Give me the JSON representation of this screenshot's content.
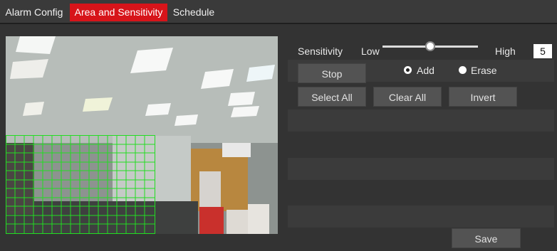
{
  "tabs": {
    "alarm_config": "Alarm Config",
    "area_sensitivity": "Area and Sensitivity",
    "schedule": "Schedule"
  },
  "sensitivity": {
    "label": "Sensitivity",
    "low": "Low",
    "high": "High",
    "value": "5",
    "level_fraction": 0.5
  },
  "controls": {
    "stop": "Stop",
    "add": "Add",
    "erase": "Erase",
    "select_all": "Select All",
    "clear_all": "Clear All",
    "invert": "Invert",
    "save": "Save"
  },
  "colors": {
    "active_tab": "#d7141a",
    "grid": "#22dd22"
  }
}
